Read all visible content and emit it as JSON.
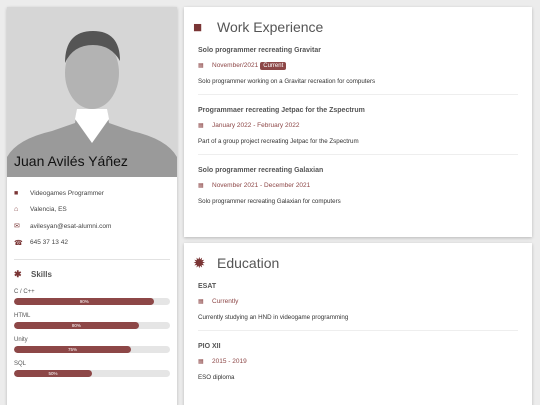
{
  "profile": {
    "name": "Juan Avilés Yáñez",
    "role": "Videogames Programmer",
    "location": "Valencia, ES",
    "email": "avilesyan@esat-alumni.com",
    "phone": "645 37 13 42"
  },
  "skills": {
    "heading": "Skills",
    "items": [
      {
        "label": "C / C++",
        "percent": 90,
        "percent_label": "90%"
      },
      {
        "label": "HTML",
        "percent": 80,
        "percent_label": "80%"
      },
      {
        "label": "Unity",
        "percent": 75,
        "percent_label": "75%"
      },
      {
        "label": "SQL",
        "percent": 50,
        "percent_label": "50%"
      }
    ]
  },
  "work": {
    "heading": "Work Experience",
    "entries": [
      {
        "title": "Solo programmer recreating Gravitar",
        "date": "November/2021",
        "badge": "Current",
        "desc": "Solo programmer working on a Gravitar recreation for computers"
      },
      {
        "title": "Programmaer recreating Jetpac for the Zspectrum",
        "date": "January 2022 - February 2022",
        "desc": "Part of a group project recreating Jetpac for the Zspectrum"
      },
      {
        "title": "Solo programmer recreating Galaxian",
        "date": "November 2021 - December 2021",
        "desc": "Solo programmer recreating Galaxian for computers"
      }
    ]
  },
  "education": {
    "heading": "Education",
    "entries": [
      {
        "title": "ESAT",
        "date": "Currently",
        "desc": "Currently studying an HND in videogame programming"
      },
      {
        "title": "PIO XII",
        "date": "2015 - 2019",
        "desc": "ESO diploma"
      }
    ]
  },
  "icons": {
    "role": "briefcase-icon",
    "location": "home-icon",
    "email": "envelope-icon",
    "phone": "phone-icon",
    "skills": "asterisk-icon",
    "work": "suitcase-icon",
    "education": "certificate-icon",
    "date": "calendar-icon"
  },
  "colors": {
    "accent": "#8d4747",
    "background": "#ececec"
  }
}
